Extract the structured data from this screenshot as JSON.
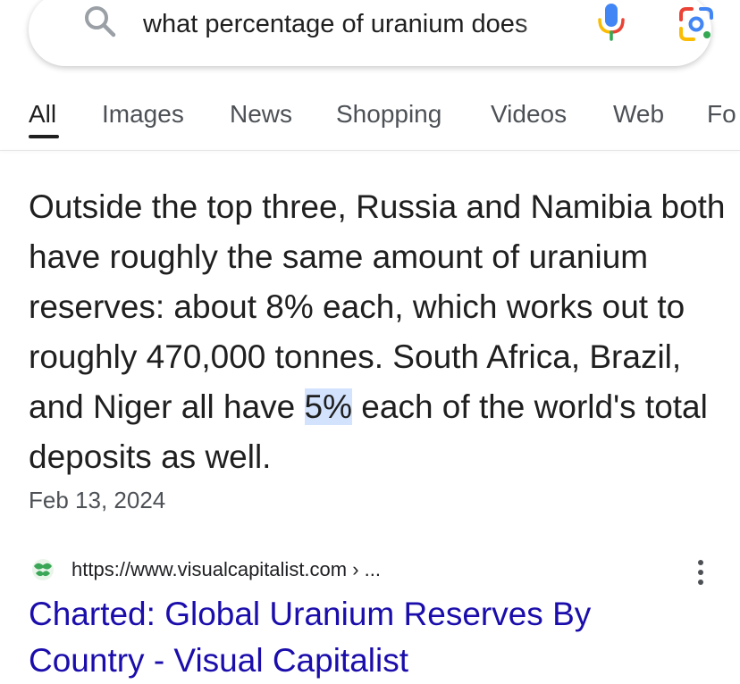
{
  "search": {
    "query": "what percentage of uranium does",
    "icon": "search-icon",
    "voice_icon": "mic-icon",
    "lens_icon": "lens-icon"
  },
  "tabs": [
    {
      "label": "All",
      "active": true
    },
    {
      "label": "Images"
    },
    {
      "label": "News"
    },
    {
      "label": "Shopping"
    },
    {
      "label": "Videos"
    },
    {
      "label": "Web"
    },
    {
      "label": "Fo"
    }
  ],
  "snippet": {
    "text_before": "Outside the top three, Russia and Namibia both have roughly the same amount of uranium reserves: about 8% each, which works out to roughly 470,000 tonnes. South Africa, Brazil, and Niger all have ",
    "highlight": "5%",
    "text_after": " each of the world's total deposits as well.",
    "date": "Feb 13, 2024"
  },
  "result": {
    "url": "https://www.visualcapitalist.com › ...",
    "title": "Charted: Global Uranium Reserves By Country - Visual Capitalist",
    "menu_icon": "more-vert-icon"
  },
  "colors": {
    "link": "#1a0dab",
    "highlight": "#d3e3fd",
    "favicon_green": "#3aa757"
  }
}
